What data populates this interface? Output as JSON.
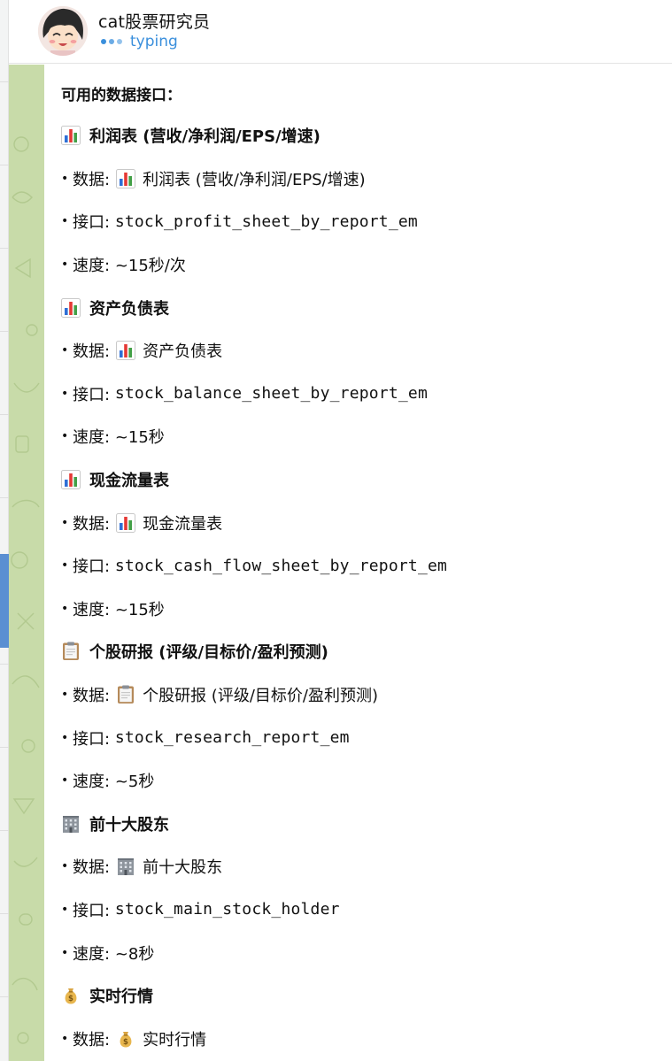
{
  "header": {
    "title": "cat股票研究员",
    "status": "typing",
    "avatar_icon": "avatar-cartoon-girl"
  },
  "message": {
    "intro": "可用的数据接口：",
    "sections": [
      {
        "icon": "bar-chart-icon",
        "title": "利润表 (营收/净利润/EPS/增速)",
        "data_label": "数据:",
        "data_value": "利润表 (营收/净利润/EPS/增速)",
        "api_label": "接口:",
        "api_value": "stock_profit_sheet_by_report_em",
        "speed_label": "速度:",
        "speed_value": "~15秒/次"
      },
      {
        "icon": "bar-chart-icon",
        "title": "资产负债表",
        "data_label": "数据:",
        "data_value": "资产负债表",
        "api_label": "接口:",
        "api_value": "stock_balance_sheet_by_report_em",
        "speed_label": "速度:",
        "speed_value": "~15秒"
      },
      {
        "icon": "bar-chart-icon",
        "title": "现金流量表",
        "data_label": "数据:",
        "data_value": "现金流量表",
        "api_label": "接口:",
        "api_value": "stock_cash_flow_sheet_by_report_em",
        "speed_label": "速度:",
        "speed_value": "~15秒"
      },
      {
        "icon": "clipboard-icon",
        "title": "个股研报 (评级/目标价/盈利预测)",
        "data_label": "数据:",
        "data_value": "个股研报 (评级/目标价/盈利预测)",
        "api_label": "接口:",
        "api_value": "stock_research_report_em",
        "speed_label": "速度:",
        "speed_value": "~5秒"
      },
      {
        "icon": "office-building-icon",
        "title": "前十大股东",
        "data_label": "数据:",
        "data_value": "前十大股东",
        "api_label": "接口:",
        "api_value": "stock_main_stock_holder",
        "speed_label": "速度:",
        "speed_value": "~8秒"
      },
      {
        "icon": "money-bag-icon",
        "title": "实时行情",
        "data_label": "数据:",
        "data_value": "实时行情"
      }
    ]
  },
  "colors": {
    "accent_blue": "#3a8fdc",
    "wallpaper_green": "#c8dba9",
    "bubble_bg": "#ffffff"
  }
}
